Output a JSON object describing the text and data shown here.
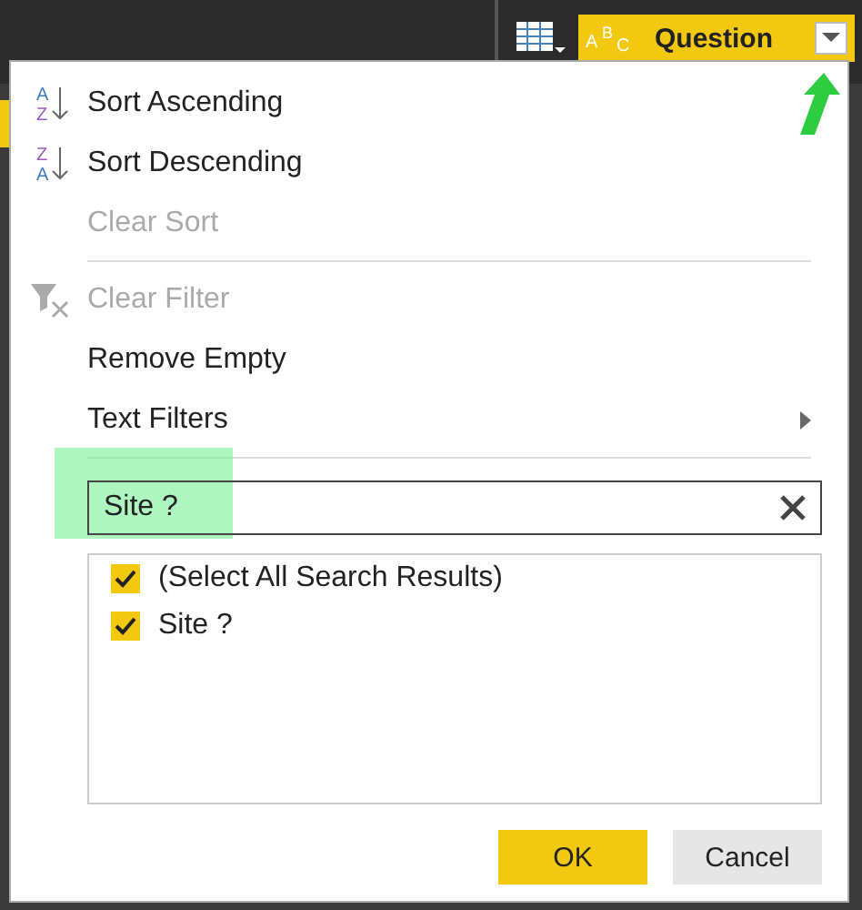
{
  "column_header": {
    "type_letters": [
      "A",
      "B",
      "C"
    ],
    "title": "Question"
  },
  "menu": {
    "groups": [
      [
        {
          "label": "Sort Ascending",
          "kind": "sort-asc",
          "icon_letters": [
            "A",
            "Z"
          ],
          "disabled": false
        },
        {
          "label": "Sort Descending",
          "kind": "sort-desc",
          "icon_letters": [
            "Z",
            "A"
          ],
          "disabled": false
        },
        {
          "label": "Clear Sort",
          "kind": "plain",
          "disabled": true
        }
      ],
      [
        {
          "label": "Clear Filter",
          "kind": "clear-filter",
          "disabled": true
        },
        {
          "label": "Remove Empty",
          "kind": "plain",
          "disabled": false
        },
        {
          "label": "Text Filters",
          "kind": "submenu",
          "disabled": false
        }
      ]
    ]
  },
  "search": {
    "value": "Site ?"
  },
  "values": [
    {
      "label": "(Select All Search Results)",
      "checked": true
    },
    {
      "label": "Site ?",
      "checked": true
    }
  ],
  "buttons": [
    {
      "label": "OK",
      "kind": "primary"
    },
    {
      "label": "Cancel",
      "kind": "secondary"
    }
  ]
}
